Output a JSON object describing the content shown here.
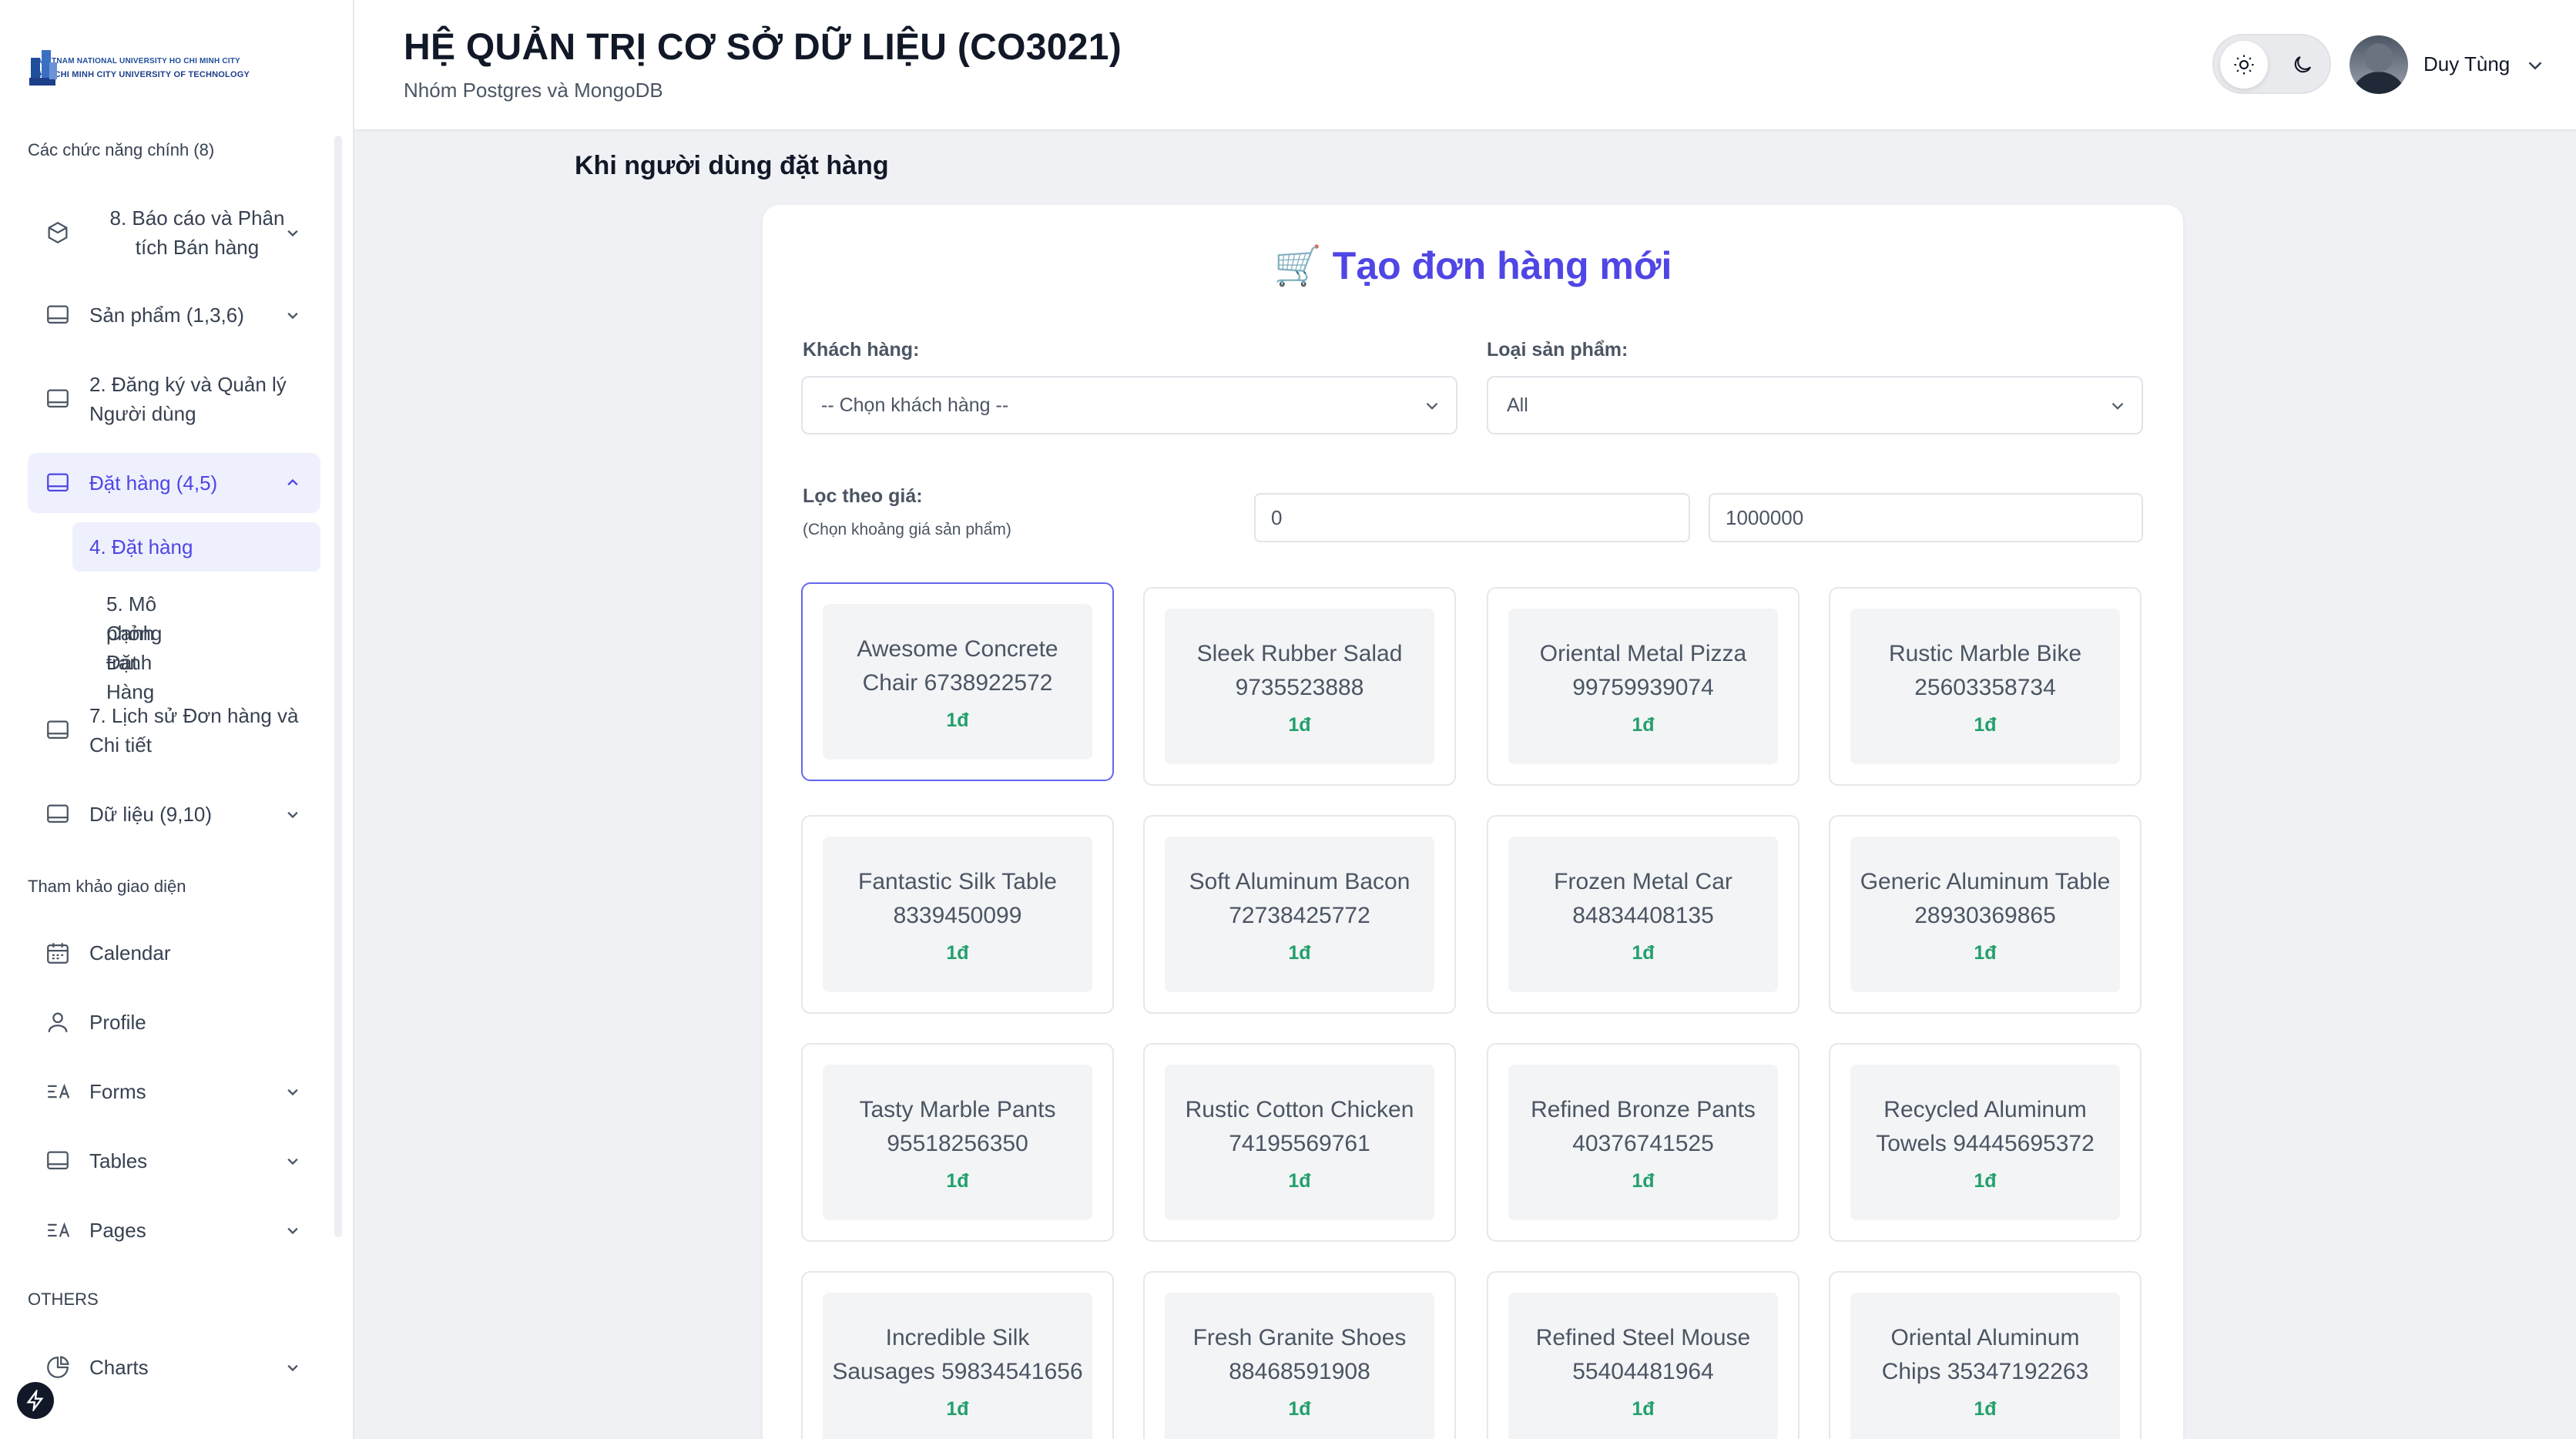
{
  "logo": {
    "line1": "VIETNAM NATIONAL UNIVERSITY HO CHI MINH CITY",
    "line2": "HO CHI MINH CITY UNIVERSITY OF TECHNOLOGY"
  },
  "header": {
    "title": "HỆ QUẢN TRỊ CƠ SỞ DỮ LIỆU (CO3021)",
    "subtitle": "Nhóm Postgres và MongoDB",
    "user_name": "Duy Tùng"
  },
  "sidebar": {
    "section_main": "Các chức năng chính (8)",
    "items": [
      {
        "label1": "8. Báo cáo và Phân",
        "label2": "tích Bán hàng",
        "icon": "box-icon"
      },
      {
        "label1": "Sản phẩm (1,3,6)",
        "icon": "table-icon"
      },
      {
        "label1": "2. Đăng ký và Quản lý",
        "label2": "Người dùng",
        "icon": "table-icon"
      },
      {
        "label1": "Đặt hàng (4,5)",
        "icon": "table-icon"
      },
      {
        "label1": "7. Lịch sử Đơn hàng và",
        "label2": "Chi tiết",
        "icon": "table-icon"
      },
      {
        "label1": "Dữ liệu (9,10)",
        "icon": "table-icon"
      }
    ],
    "sub_items": [
      {
        "label1": "4. Đặt hàng"
      },
      {
        "label1": "5. Mô phỏng Đặt Hàng",
        "label2": "Cạnh tranh"
      }
    ],
    "section_ref": "Tham khảo giao diện",
    "ref_items": [
      {
        "label": "Calendar",
        "icon": "calendar-icon"
      },
      {
        "label": "Profile",
        "icon": "user-icon"
      },
      {
        "label": "Forms",
        "icon": "forms-icon"
      },
      {
        "label": "Tables",
        "icon": "table-icon"
      },
      {
        "label": "Pages",
        "icon": "pages-icon"
      }
    ],
    "section_others": "OTHERS",
    "others_items": [
      {
        "label": "Charts",
        "icon": "pie-chart-icon"
      }
    ]
  },
  "main": {
    "heading": "Khi người dùng đặt hàng",
    "form_title": "🛒 Tạo đơn hàng mới",
    "customer_label": "Khách hàng:",
    "customer_value": "-- Chọn khách hàng --",
    "category_label": "Loại sản phẩm:",
    "category_value": "All",
    "price_label": "Lọc theo giá:",
    "price_hint": "(Chọn khoảng giá sản phẩm)",
    "price_min": "0",
    "price_max": "1000000"
  },
  "products": [
    {
      "name": "Awesome Concrete Chair 6738922572",
      "price": "1đ"
    },
    {
      "name": "Sleek Rubber Salad 9735523888",
      "price": "1đ"
    },
    {
      "name": "Oriental Metal Pizza 99759939074",
      "price": "1đ"
    },
    {
      "name": "Rustic Marble Bike 25603358734",
      "price": "1đ"
    },
    {
      "name": "Fantastic Silk Table 8339450099",
      "price": "1đ"
    },
    {
      "name": "Soft Aluminum Bacon 72738425772",
      "price": "1đ"
    },
    {
      "name": "Frozen Metal Car 84834408135",
      "price": "1đ"
    },
    {
      "name": "Generic Aluminum Table 28930369865",
      "price": "1đ"
    },
    {
      "name": "Tasty Marble Pants 95518256350",
      "price": "1đ"
    },
    {
      "name": "Rustic Cotton Chicken 74195569761",
      "price": "1đ"
    },
    {
      "name": "Refined Bronze Pants 40376741525",
      "price": "1đ"
    },
    {
      "name": "Recycled Aluminum Towels 94445695372",
      "price": "1đ"
    },
    {
      "name": "Incredible Silk Sausages 59834541656",
      "price": "1đ"
    },
    {
      "name": "Fresh Granite Shoes 88468591908",
      "price": "1đ"
    },
    {
      "name": "Refined Steel Mouse 55404481964",
      "price": "1đ"
    },
    {
      "name": "Oriental Aluminum Chips 35347192263",
      "price": "1đ"
    }
  ],
  "colors": {
    "accent": "#4f46e5",
    "price": "#22a06b",
    "background": "#f0f1f4"
  }
}
